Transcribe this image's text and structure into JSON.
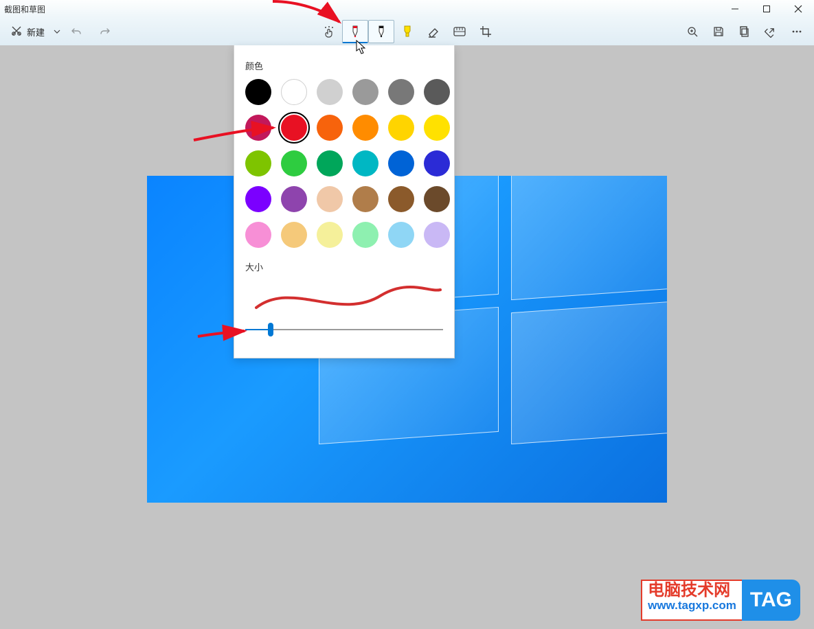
{
  "window": {
    "title": "截图和草图"
  },
  "toolbar": {
    "new_label": "新建",
    "tools": {
      "touch": {
        "selected": false
      },
      "pen_red": {
        "selected": true
      },
      "pen_black": {
        "selected": false
      },
      "highlighter": {
        "selected": false
      },
      "eraser": {
        "selected": false
      },
      "ruler": {
        "selected": false
      },
      "crop": {
        "selected": false
      }
    }
  },
  "popup": {
    "color_label": "颜色",
    "size_label": "大小",
    "selected_color_index": 7,
    "colors": [
      "#000000",
      "#ffffff",
      "#d0d0d0",
      "#9a9a9a",
      "#787878",
      "#5a5a5a",
      "#c2185b",
      "#e81123",
      "#f7630c",
      "#ff8c00",
      "#ffd400",
      "#ffe100",
      "#7ec400",
      "#2ecc40",
      "#00a65a",
      "#00b7c3",
      "#0063d6",
      "#2b2bd6",
      "#7b00ff",
      "#8e44ad",
      "#f0c8a8",
      "#b07d4a",
      "#8b5a2b",
      "#6b4a2b",
      "#f78fd6",
      "#f5c97a",
      "#f5f09a",
      "#8ef0b0",
      "#8fd6f5",
      "#c9b8f5"
    ],
    "preview_stroke_color": "#d32f2f",
    "slider": {
      "min": 1,
      "max": 30,
      "value": 5,
      "fill_percent": 13
    }
  },
  "watermark": {
    "line1": "电脑技术网",
    "line2": "www.tagxp.com",
    "badge": "TAG"
  }
}
